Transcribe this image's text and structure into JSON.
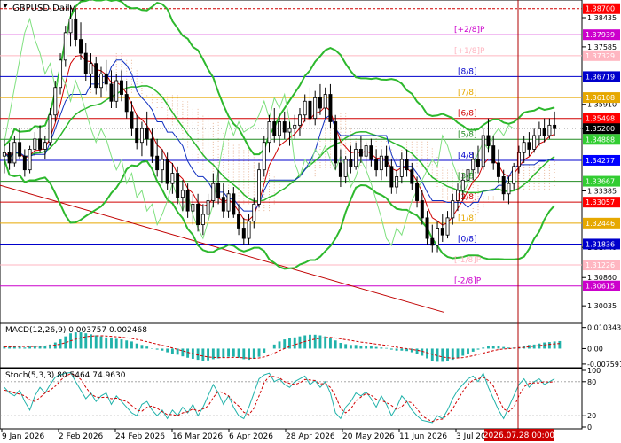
{
  "chart_data": {
    "type": "candlestick",
    "symbol_title": "GBPUSD,Daily",
    "price_axis": {
      "ylim": [
        1.296,
        1.389
      ],
      "ticks": [
        "1.38435",
        "1.37585",
        "1.35910",
        "1.35200",
        "1.33385",
        "1.31740",
        "1.30860",
        "1.30035"
      ]
    },
    "levels": [
      {
        "label": "[+2/8]P",
        "price_label": "1.37939",
        "value": 1.37939,
        "color": "#cc00cc",
        "tag_bg": "#cc00cc",
        "dashed": false
      },
      {
        "label": "[+1/8]P",
        "price_label": "1.37329",
        "value": 1.37329,
        "color": "#ffb6c1",
        "tag_bg": "#ffb6c1",
        "dashed": false
      },
      {
        "label": "[8/8]",
        "price_label": "1.36719",
        "value": 1.36719,
        "color": "#0000cc",
        "tag_bg": "#0000cc",
        "dashed": false
      },
      {
        "label": "[7/8]",
        "price_label": "1.36108",
        "value": 1.36108,
        "color": "#e6a800",
        "tag_bg": "#e6a800",
        "dashed": false
      },
      {
        "label": "[6/8]",
        "price_label": "1.35498",
        "value": 1.35498,
        "color": "#d00000",
        "tag_bg": "#ff0000",
        "dashed": false
      },
      {
        "label": "[5/8]",
        "price_label": "1.34888",
        "value": 1.34888,
        "color": "#228b22",
        "tag_bg": "#32cd32",
        "dashed": false
      },
      {
        "label": "[4/8]",
        "price_label": "1.34277",
        "value": 1.34277,
        "color": "#0000cc",
        "tag_bg": "#0000ff",
        "dashed": false
      },
      {
        "label": "[3/8]",
        "price_label": "1.33667",
        "value": 1.33667,
        "color": "#228b22",
        "tag_bg": "#32cd32",
        "dashed": false
      },
      {
        "label": "[2/8]",
        "price_label": "1.33057",
        "value": 1.33057,
        "color": "#d00000",
        "tag_bg": "#ff0000",
        "dashed": false
      },
      {
        "label": "[1/8]",
        "price_label": "1.32446",
        "value": 1.32446,
        "color": "#e6a800",
        "tag_bg": "#e6a800",
        "dashed": false
      },
      {
        "label": "[0/8]",
        "price_label": "1.31836",
        "value": 1.31836,
        "color": "#0000cc",
        "tag_bg": "#0000cc",
        "dashed": false
      },
      {
        "label": "[-1/8]P",
        "price_label": "1.31226",
        "value": 1.31226,
        "color": "#ffb6c1",
        "tag_bg": "#ffb6c1",
        "dashed": false
      },
      {
        "label": "[-2/8]P",
        "price_label": "1.30615",
        "value": 1.30615,
        "color": "#cc00cc",
        "tag_bg": "#cc00cc",
        "dashed": false
      }
    ],
    "top_level": {
      "price_label": "1.38700",
      "value": 1.387,
      "color": "#d00000",
      "tag_bg": "#ff0000"
    },
    "current_price": {
      "price_label": "1.35200",
      "value": 1.352
    },
    "time_axis": {
      "ticks": [
        "9 Jan 2026",
        "2 Feb 2026",
        "24 Feb 2026",
        "16 Mar 2026",
        "6 Apr 2026",
        "28 Apr 2026",
        "20 May 2026",
        "11 Jun 2026",
        "3 Jul 2026"
      ],
      "cursor_label": "2026.07.28 00:00"
    },
    "candles": [
      [
        1.344,
        1.349,
        1.339,
        1.345
      ],
      [
        1.345,
        1.348,
        1.34,
        1.342
      ],
      [
        1.342,
        1.35,
        1.341,
        1.348
      ],
      [
        1.348,
        1.352,
        1.343,
        1.344
      ],
      [
        1.344,
        1.346,
        1.338,
        1.34
      ],
      [
        1.34,
        1.347,
        1.339,
        1.346
      ],
      [
        1.346,
        1.351,
        1.344,
        1.349
      ],
      [
        1.349,
        1.353,
        1.345,
        1.346
      ],
      [
        1.346,
        1.35,
        1.343,
        1.348
      ],
      [
        1.348,
        1.358,
        1.347,
        1.356
      ],
      [
        1.356,
        1.366,
        1.354,
        1.364
      ],
      [
        1.364,
        1.374,
        1.362,
        1.372
      ],
      [
        1.372,
        1.382,
        1.37,
        1.38
      ],
      [
        1.38,
        1.388,
        1.376,
        1.384
      ],
      [
        1.384,
        1.387,
        1.376,
        1.378
      ],
      [
        1.378,
        1.383,
        1.372,
        1.374
      ],
      [
        1.374,
        1.377,
        1.366,
        1.368
      ],
      [
        1.368,
        1.374,
        1.364,
        1.371
      ],
      [
        1.371,
        1.373,
        1.362,
        1.364
      ],
      [
        1.364,
        1.37,
        1.361,
        1.368
      ],
      [
        1.368,
        1.372,
        1.363,
        1.365
      ],
      [
        1.365,
        1.369,
        1.358,
        1.36
      ],
      [
        1.36,
        1.368,
        1.358,
        1.366
      ],
      [
        1.366,
        1.369,
        1.36,
        1.362
      ],
      [
        1.362,
        1.366,
        1.355,
        1.357
      ],
      [
        1.357,
        1.36,
        1.35,
        1.352
      ],
      [
        1.352,
        1.356,
        1.346,
        1.348
      ],
      [
        1.348,
        1.354,
        1.344,
        1.352
      ],
      [
        1.352,
        1.357,
        1.347,
        1.349
      ],
      [
        1.349,
        1.352,
        1.342,
        1.344
      ],
      [
        1.344,
        1.349,
        1.338,
        1.34
      ],
      [
        1.34,
        1.346,
        1.336,
        1.343
      ],
      [
        1.343,
        1.345,
        1.334,
        1.336
      ],
      [
        1.336,
        1.342,
        1.333,
        1.339
      ],
      [
        1.339,
        1.341,
        1.33,
        1.332
      ],
      [
        1.332,
        1.337,
        1.328,
        1.334
      ],
      [
        1.334,
        1.336,
        1.326,
        1.328
      ],
      [
        1.328,
        1.333,
        1.324,
        1.33
      ],
      [
        1.33,
        1.333,
        1.322,
        1.324
      ],
      [
        1.324,
        1.33,
        1.321,
        1.327
      ],
      [
        1.327,
        1.333,
        1.325,
        1.331
      ],
      [
        1.331,
        1.339,
        1.329,
        1.336
      ],
      [
        1.336,
        1.34,
        1.33,
        1.332
      ],
      [
        1.332,
        1.336,
        1.326,
        1.328
      ],
      [
        1.328,
        1.334,
        1.326,
        1.333
      ],
      [
        1.333,
        1.335,
        1.326,
        1.327
      ],
      [
        1.327,
        1.33,
        1.321,
        1.323
      ],
      [
        1.323,
        1.326,
        1.318,
        1.32
      ],
      [
        1.32,
        1.327,
        1.318,
        1.325
      ],
      [
        1.325,
        1.332,
        1.323,
        1.33
      ],
      [
        1.33,
        1.342,
        1.329,
        1.34
      ],
      [
        1.34,
        1.35,
        1.338,
        1.348
      ],
      [
        1.348,
        1.356,
        1.345,
        1.354
      ],
      [
        1.354,
        1.358,
        1.348,
        1.35
      ],
      [
        1.35,
        1.356,
        1.347,
        1.354
      ],
      [
        1.354,
        1.357,
        1.349,
        1.351
      ],
      [
        1.351,
        1.354,
        1.347,
        1.352
      ],
      [
        1.352,
        1.356,
        1.349,
        1.353
      ],
      [
        1.353,
        1.358,
        1.35,
        1.356
      ],
      [
        1.356,
        1.362,
        1.354,
        1.36
      ],
      [
        1.36,
        1.364,
        1.353,
        1.355
      ],
      [
        1.355,
        1.363,
        1.353,
        1.361
      ],
      [
        1.361,
        1.365,
        1.356,
        1.358
      ],
      [
        1.358,
        1.364,
        1.355,
        1.362
      ],
      [
        1.362,
        1.365,
        1.352,
        1.354
      ],
      [
        1.354,
        1.356,
        1.34,
        1.342
      ],
      [
        1.342,
        1.346,
        1.335,
        1.338
      ],
      [
        1.338,
        1.344,
        1.336,
        1.343
      ],
      [
        1.343,
        1.347,
        1.339,
        1.341
      ],
      [
        1.341,
        1.348,
        1.34,
        1.346
      ],
      [
        1.346,
        1.35,
        1.342,
        1.344
      ],
      [
        1.344,
        1.348,
        1.34,
        1.347
      ],
      [
        1.347,
        1.349,
        1.341,
        1.343
      ],
      [
        1.343,
        1.346,
        1.338,
        1.34
      ],
      [
        1.34,
        1.346,
        1.337,
        1.344
      ],
      [
        1.344,
        1.347,
        1.338,
        1.341
      ],
      [
        1.341,
        1.343,
        1.333,
        1.335
      ],
      [
        1.335,
        1.34,
        1.333,
        1.338
      ],
      [
        1.338,
        1.345,
        1.336,
        1.343
      ],
      [
        1.343,
        1.346,
        1.338,
        1.34
      ],
      [
        1.34,
        1.342,
        1.334,
        1.336
      ],
      [
        1.336,
        1.338,
        1.329,
        1.331
      ],
      [
        1.331,
        1.334,
        1.324,
        1.326
      ],
      [
        1.326,
        1.328,
        1.318,
        1.32
      ],
      [
        1.32,
        1.324,
        1.316,
        1.318
      ],
      [
        1.318,
        1.325,
        1.316,
        1.323
      ],
      [
        1.323,
        1.327,
        1.319,
        1.321
      ],
      [
        1.321,
        1.328,
        1.32,
        1.326
      ],
      [
        1.326,
        1.333,
        1.324,
        1.331
      ],
      [
        1.331,
        1.336,
        1.328,
        1.334
      ],
      [
        1.334,
        1.339,
        1.331,
        1.337
      ],
      [
        1.337,
        1.342,
        1.334,
        1.34
      ],
      [
        1.34,
        1.345,
        1.337,
        1.343
      ],
      [
        1.343,
        1.347,
        1.339,
        1.341
      ],
      [
        1.341,
        1.352,
        1.34,
        1.35
      ],
      [
        1.35,
        1.355,
        1.345,
        1.347
      ],
      [
        1.347,
        1.35,
        1.34,
        1.342
      ],
      [
        1.342,
        1.346,
        1.336,
        1.338
      ],
      [
        1.338,
        1.34,
        1.331,
        1.333
      ],
      [
        1.333,
        1.338,
        1.33,
        1.336
      ],
      [
        1.336,
        1.342,
        1.334,
        1.341
      ],
      [
        1.341,
        1.347,
        1.339,
        1.345
      ],
      [
        1.345,
        1.35,
        1.342,
        1.348
      ],
      [
        1.348,
        1.351,
        1.344,
        1.346
      ],
      [
        1.346,
        1.352,
        1.345,
        1.35
      ],
      [
        1.35,
        1.354,
        1.347,
        1.352
      ],
      [
        1.352,
        1.355,
        1.348,
        1.35
      ],
      [
        1.35,
        1.355,
        1.349,
        1.353
      ],
      [
        1.353,
        1.357,
        1.35,
        1.352
      ]
    ],
    "macd": {
      "label": "MACD(12,26,9) 0.003757 0.002468",
      "ylim": [
        -0.0085,
        0.0115
      ],
      "ticks": [
        "0.010343",
        "0.00",
        "-0.007591"
      ],
      "hist": [
        0.001,
        0.001,
        0.0015,
        0.001,
        0.0005,
        0.001,
        0.0015,
        0.0015,
        0.0015,
        0.002,
        0.003,
        0.0045,
        0.006,
        0.0075,
        0.008,
        0.008,
        0.0075,
        0.007,
        0.0065,
        0.006,
        0.0055,
        0.005,
        0.0048,
        0.0045,
        0.004,
        0.0035,
        0.0025,
        0.0018,
        0.001,
        0.0002,
        -0.0005,
        -0.001,
        -0.0018,
        -0.0025,
        -0.003,
        -0.0038,
        -0.0045,
        -0.005,
        -0.0055,
        -0.006,
        -0.0058,
        -0.0052,
        -0.0048,
        -0.0045,
        -0.004,
        -0.004,
        -0.0045,
        -0.0052,
        -0.0055,
        -0.005,
        -0.004,
        -0.002,
        0.0,
        0.002,
        0.0035,
        0.0045,
        0.005,
        0.0055,
        0.006,
        0.0065,
        0.0068,
        0.0068,
        0.0065,
        0.006,
        0.0055,
        0.004,
        0.0028,
        0.0022,
        0.0018,
        0.0018,
        0.0015,
        0.0015,
        0.0012,
        0.0008,
        0.0005,
        0.0003,
        -0.0005,
        -0.001,
        -0.001,
        -0.0012,
        -0.0018,
        -0.0025,
        -0.0035,
        -0.0048,
        -0.006,
        -0.0065,
        -0.0065,
        -0.0062,
        -0.0055,
        -0.0045,
        -0.0035,
        -0.0025,
        -0.0015,
        -0.0005,
        0.0005,
        0.0012,
        0.0015,
        0.0012,
        0.0008,
        0.0005,
        0.0005,
        0.0008,
        0.0012,
        0.0018,
        0.002,
        0.0025,
        0.003,
        0.0032,
        0.0035,
        0.0037
      ],
      "signal": [
        0.0008,
        0.0009,
        0.001,
        0.0011,
        0.001,
        0.001,
        0.0011,
        0.0012,
        0.0013,
        0.0014,
        0.0017,
        0.0022,
        0.0029,
        0.0038,
        0.0046,
        0.0053,
        0.0058,
        0.0061,
        0.0063,
        0.0063,
        0.0062,
        0.006,
        0.0058,
        0.0056,
        0.0053,
        0.005,
        0.0045,
        0.004,
        0.0034,
        0.0028,
        0.0022,
        0.0016,
        0.001,
        0.0003,
        -0.0004,
        -0.0011,
        -0.0018,
        -0.0025,
        -0.0031,
        -0.0037,
        -0.0041,
        -0.0043,
        -0.0044,
        -0.0044,
        -0.0044,
        -0.0043,
        -0.0044,
        -0.0045,
        -0.0047,
        -0.0048,
        -0.0046,
        -0.0041,
        -0.0033,
        -0.0022,
        -0.001,
        0.0,
        0.001,
        0.0019,
        0.0027,
        0.0035,
        0.0041,
        0.0047,
        0.0051,
        0.0054,
        0.0055,
        0.0052,
        0.0048,
        0.0044,
        0.004,
        0.0036,
        0.0032,
        0.0029,
        0.0026,
        0.0022,
        0.0019,
        0.0016,
        0.0011,
        0.0007,
        0.0003,
        0.0,
        -0.0004,
        -0.0008,
        -0.0013,
        -0.002,
        -0.0028,
        -0.0035,
        -0.0041,
        -0.0045,
        -0.0047,
        -0.0046,
        -0.0044,
        -0.004,
        -0.0035,
        -0.0029,
        -0.0022,
        -0.0016,
        -0.001,
        -0.0005,
        -0.0002,
        0.0,
        0.0002,
        0.0004,
        0.0006,
        0.0009,
        0.0012,
        0.0015,
        0.0018,
        0.0021,
        0.0023,
        0.0025
      ]
    },
    "stoch": {
      "label": "Stoch(5,3,3) 80.5464 74.9630",
      "ylim": [
        0,
        100
      ],
      "ticks": [
        "100",
        "80",
        "20",
        "0"
      ],
      "main": [
        70,
        60,
        55,
        65,
        45,
        30,
        55,
        70,
        60,
        75,
        88,
        92,
        95,
        96,
        80,
        65,
        50,
        60,
        45,
        55,
        60,
        40,
        55,
        45,
        35,
        25,
        20,
        40,
        45,
        30,
        20,
        30,
        15,
        30,
        20,
        35,
        25,
        40,
        20,
        35,
        55,
        75,
        60,
        40,
        55,
        35,
        20,
        15,
        35,
        60,
        85,
        92,
        95,
        80,
        85,
        75,
        70,
        80,
        85,
        90,
        75,
        82,
        70,
        80,
        60,
        25,
        15,
        35,
        45,
        60,
        55,
        62,
        50,
        35,
        55,
        40,
        20,
        35,
        55,
        45,
        30,
        20,
        12,
        10,
        8,
        20,
        15,
        30,
        50,
        65,
        75,
        85,
        90,
        80,
        95,
        70,
        50,
        30,
        15,
        35,
        55,
        75,
        85,
        70,
        80,
        85,
        75,
        80,
        85
      ],
      "signal": [
        65,
        63,
        60,
        58,
        55,
        48,
        45,
        52,
        60,
        65,
        72,
        82,
        90,
        94,
        91,
        84,
        70,
        58,
        53,
        52,
        53,
        50,
        51,
        48,
        45,
        38,
        30,
        28,
        35,
        37,
        33,
        27,
        22,
        22,
        20,
        25,
        27,
        32,
        28,
        32,
        37,
        52,
        63,
        60,
        55,
        45,
        37,
        26,
        22,
        33,
        55,
        78,
        90,
        89,
        87,
        80,
        77,
        75,
        78,
        84,
        83,
        82,
        76,
        77,
        70,
        55,
        33,
        25,
        32,
        46,
        53,
        59,
        56,
        49,
        47,
        43,
        38,
        31,
        36,
        45,
        43,
        32,
        20,
        14,
        10,
        13,
        14,
        22,
        32,
        48,
        63,
        75,
        83,
        85,
        88,
        82,
        72,
        50,
        32,
        27,
        35,
        55,
        71,
        77,
        78,
        78,
        80,
        79,
        80
      ]
    }
  }
}
